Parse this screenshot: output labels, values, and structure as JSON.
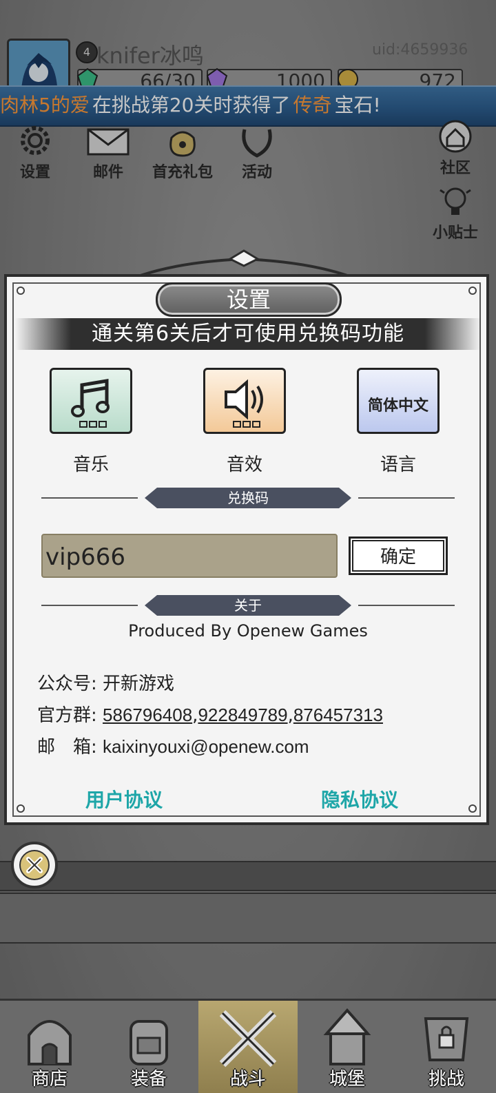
{
  "player": {
    "level": "4",
    "name": "knifer冰鸣",
    "uid": "uid:4659936",
    "resources": [
      {
        "icon": "green-gem-icon",
        "value": "66/30"
      },
      {
        "icon": "purple-gem-icon",
        "value": "1000"
      },
      {
        "icon": "gold-coin-icon",
        "value": "972"
      }
    ]
  },
  "banner": {
    "player": "肉林5的爱",
    "text1": "在挑战第20关时获得了",
    "rarity": "传奇",
    "text2": "宝石!"
  },
  "top_menu": {
    "settings": "设置",
    "mail": "邮件",
    "first_recharge": "首充礼包",
    "events": "活动",
    "community": "社区",
    "tips": "小贴士"
  },
  "dialog": {
    "title": "设置",
    "notice": "通关第6关后才可使用兑换码功能",
    "options": {
      "music": "音乐",
      "sfx": "音效",
      "language": "语言",
      "language_value": "简体中文"
    },
    "redeem": {
      "section_title": "兑换码",
      "input_value": "vip666",
      "confirm_label": "确定"
    },
    "about": {
      "section_title": "关于",
      "produced": "Produced By Openew Games",
      "wechat_label": "公众号:",
      "wechat_value": "开新游戏",
      "group_label": "官方群:",
      "groups": [
        "586796408",
        "922849789",
        "876457313"
      ],
      "email_label": "邮　箱:",
      "email_value": "kaixinyouxi@openew.com"
    },
    "links": {
      "user_agreement": "用户协议",
      "privacy": "隐私协议"
    }
  },
  "bottom_nav": [
    {
      "label": "商店",
      "icon": "shop-icon"
    },
    {
      "label": "装备",
      "icon": "backpack-icon"
    },
    {
      "label": "战斗",
      "icon": "crossed-swords-icon",
      "active": true
    },
    {
      "label": "城堡",
      "icon": "castle-icon"
    },
    {
      "label": "挑战",
      "icon": "challenge-icon"
    }
  ],
  "colors": {
    "banner_blue": "#2d5f90",
    "highlight_orange": "#ff9a3c",
    "link_teal": "#1ea6a8",
    "music_tile": "#cfe8dc",
    "sfx_tile": "#f6d7ae",
    "language_tile": "#d5dcf3"
  }
}
